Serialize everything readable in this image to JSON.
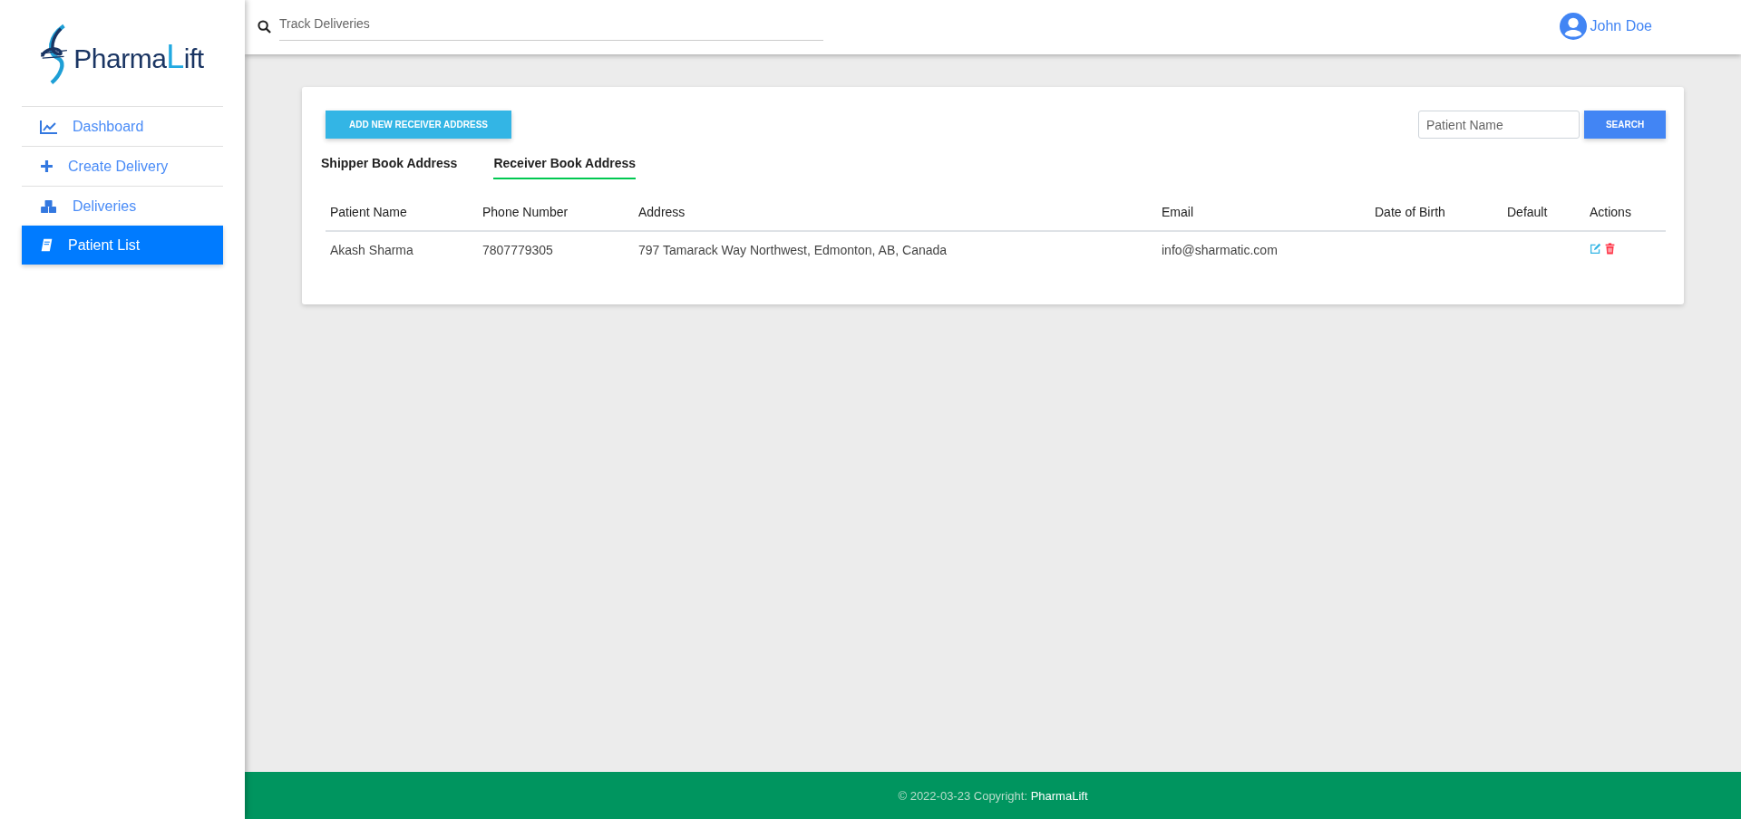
{
  "logo": {
    "parts": [
      {
        "text": "Pharma",
        "accent": false
      },
      {
        "text": "L",
        "accent": true
      },
      {
        "text": "ift",
        "accent": false
      }
    ]
  },
  "sidebar": {
    "items": [
      {
        "label": "Dashboard",
        "kind": "chart",
        "selected": false
      },
      {
        "label": "Create Delivery",
        "kind": "plus",
        "selected": false
      },
      {
        "label": "Deliveries",
        "kind": "cubes",
        "selected": false
      },
      {
        "label": "Patient List",
        "kind": "book",
        "selected": true
      }
    ]
  },
  "header": {
    "search": {
      "placeholder": "Track Deliveries"
    },
    "user": {
      "name": "John Doe"
    }
  },
  "card": {
    "add_button": "ADD NEW RECEIVER ADDRESS",
    "search": {
      "placeholder": "Patient Name"
    },
    "search_button": "SEARCH",
    "tabs": [
      {
        "label": "Shipper Book Address",
        "selected": false
      },
      {
        "label": "Receiver Book Address",
        "selected": true
      }
    ],
    "table": {
      "columns": [
        "Patient Name",
        "Phone Number",
        "Address",
        "Email",
        "Date of Birth",
        "Default",
        "Actions"
      ],
      "rows": [
        {
          "patient_name": "Akash Sharma",
          "phone": "7807779305",
          "address": "797 Tamarack Way Northwest, Edmonton, AB, Canada",
          "email": "info@sharmatic.com"
        }
      ]
    }
  },
  "footer": {
    "text": "© 2022-03-23 Copyright: ",
    "link": "PharmaLift"
  }
}
